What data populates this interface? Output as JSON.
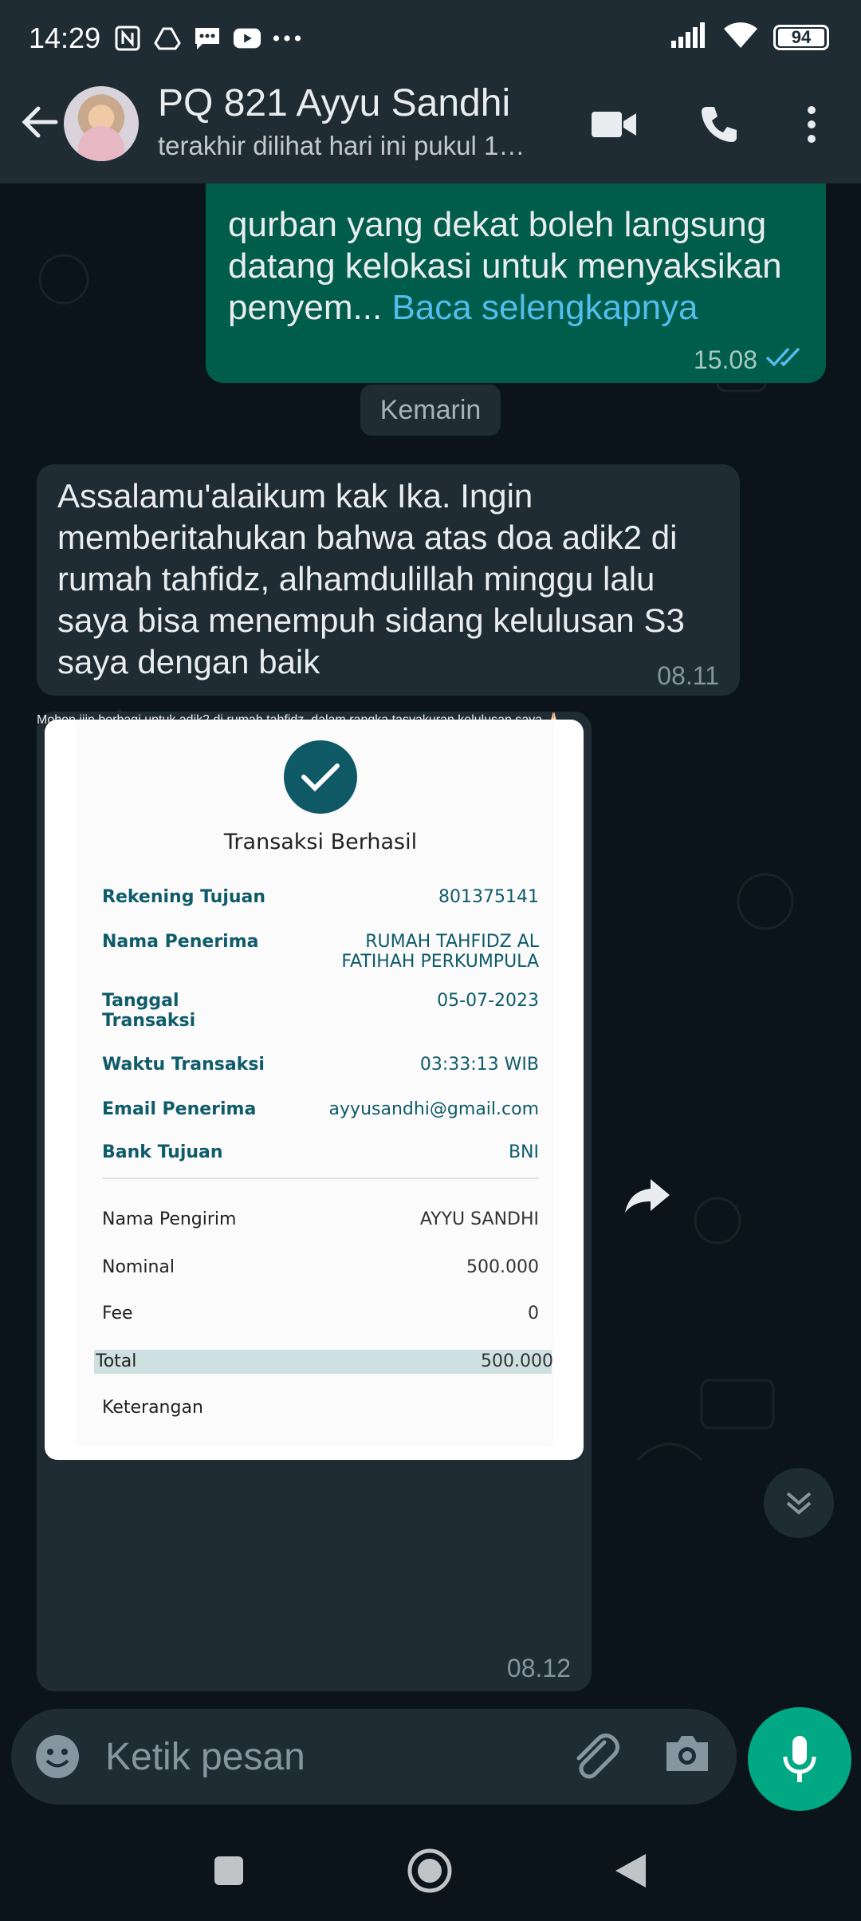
{
  "status_bar": {
    "time": "14:29",
    "battery": "94",
    "icons": [
      "nfc-icon",
      "drive-icon",
      "message-icon",
      "youtube-icon",
      "more-dots-icon",
      "signal-icon",
      "wifi-icon",
      "battery-icon"
    ]
  },
  "header": {
    "contact_name": "PQ 821 Ayyu Sandhi",
    "contact_status": "terakhir dilihat hari ini pukul 1…"
  },
  "messages": {
    "outgoing_top": {
      "text": "qurban yang dekat boleh langsung datang kelokasi untuk menyaksikan penyem...",
      "read_more": "Baca selengkapnya",
      "time": "15.08"
    },
    "date_chip": "Kemarin",
    "incoming_1": {
      "text": "Assalamu'alaikum kak Ika. Ingin memberitahukan bahwa atas doa adik2 di rumah tahfidz, alhamdulillah minggu lalu saya bisa menempuh sidang kelulusan S3 saya dengan baik",
      "time": "08.11"
    },
    "incoming_2": {
      "caption": "Mohon ijin berbagi untuk adik2 di rumah tahfidz, dalam rangka tasyakuran kelulusan saya 🙏🏻",
      "time": "08.12"
    }
  },
  "receipt": {
    "title": "Transaksi Berhasil",
    "rows": [
      {
        "label": "Rekening Tujuan",
        "value": "801375141"
      },
      {
        "label": "Nama Penerima",
        "value": "RUMAH TAHFIDZ AL FATIHAH PERKUMPULA"
      },
      {
        "label": "Tanggal Transaksi",
        "value": "05-07-2023"
      },
      {
        "label": "Waktu Transaksi",
        "value": "03:33:13 WIB"
      },
      {
        "label": "Email Penerima",
        "value": "ayyusandhi@gmail.com"
      },
      {
        "label": "Bank Tujuan",
        "value": "BNI"
      }
    ],
    "rows2": [
      {
        "label": "Nama Pengirim",
        "value": "AYYU SANDHI"
      },
      {
        "label": "Nominal",
        "value": "500.000"
      },
      {
        "label": "Fee",
        "value": "0"
      },
      {
        "label": "Total",
        "value": "500.000"
      },
      {
        "label": "Keterangan",
        "value": ""
      }
    ]
  },
  "composer": {
    "placeholder": "Ketik pesan"
  },
  "colors": {
    "header_bg": "#1f2c34",
    "chat_bg": "#0b141a",
    "outgoing_bubble": "#005c4b",
    "incoming_bubble": "#1f2c34",
    "accent": "#00a884",
    "link": "#53bdeb"
  }
}
